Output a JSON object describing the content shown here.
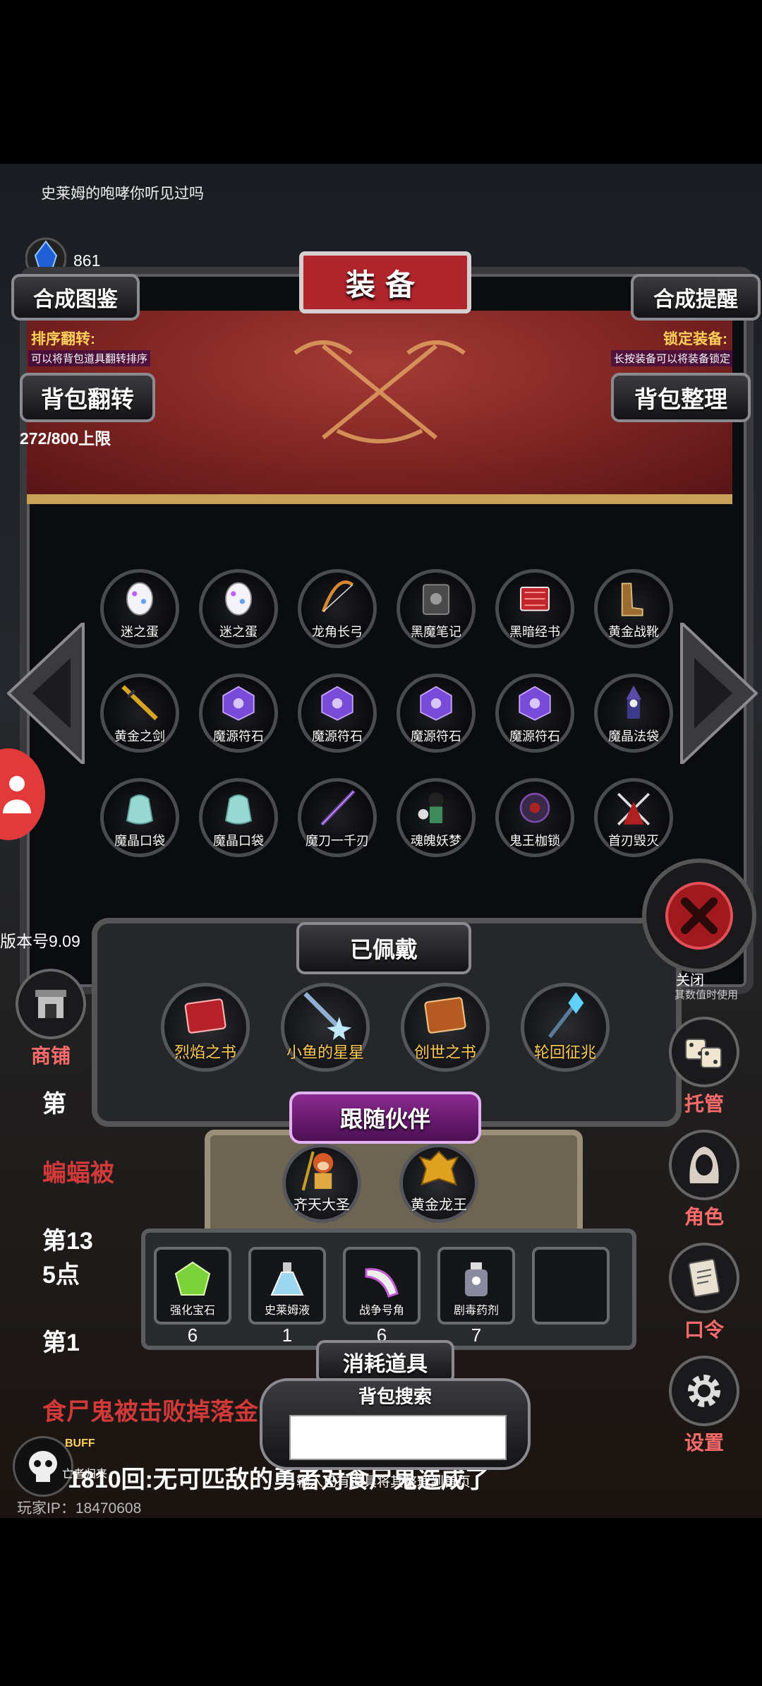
{
  "top_message": "史莱姆的咆哮你听见过吗",
  "currency": {
    "icon": "blue-crystal-icon",
    "value": "861"
  },
  "header": {
    "title": "装备",
    "codex_button": "合成图鉴",
    "synthesis_hint_button": "合成提醒",
    "sort_flip_label": "排序翻转:",
    "sort_flip_desc": "可以将背包道具翻转排序",
    "lock_label": "锁定装备:",
    "lock_desc": "长按装备可以将装备锁定",
    "flip_button": "背包翻转",
    "arrange_button": "背包整理",
    "capacity": "272/800上限"
  },
  "inventory": [
    {
      "label": "迷之蛋",
      "icon": "mystery-egg-icon",
      "color": "#f2f2f8"
    },
    {
      "label": "迷之蛋",
      "icon": "mystery-egg-icon",
      "color": "#f2f2f8"
    },
    {
      "label": "龙角长弓",
      "icon": "longbow-icon",
      "color": "#d68a2e"
    },
    {
      "label": "黑魔笔记",
      "icon": "dark-notebook-icon",
      "color": "#4a4a4a"
    },
    {
      "label": "黑暗经书",
      "icon": "red-scripture-icon",
      "color": "#c0262b"
    },
    {
      "label": "黄金战靴",
      "icon": "golden-boots-icon",
      "color": "#9c6b32"
    },
    {
      "label": "黄金之剑",
      "icon": "golden-sword-icon",
      "color": "#d8a520"
    },
    {
      "label": "魔源符石",
      "icon": "purple-rune-stone-icon",
      "color": "#7a4ad8"
    },
    {
      "label": "魔源符石",
      "icon": "purple-rune-stone-icon",
      "color": "#7a4ad8"
    },
    {
      "label": "魔源符石",
      "icon": "purple-rune-stone-icon",
      "color": "#7a4ad8"
    },
    {
      "label": "魔源符石",
      "icon": "purple-rune-stone-icon",
      "color": "#7a4ad8"
    },
    {
      "label": "魔晶法袋",
      "icon": "wizard-icon",
      "color": "#5b4aa8"
    },
    {
      "label": "魔晶口袋",
      "icon": "crystal-pouch-icon",
      "color": "#9ad8d4"
    },
    {
      "label": "魔晶口袋",
      "icon": "crystal-pouch-icon",
      "color": "#9ad8d4"
    },
    {
      "label": "魔刀一千刃",
      "icon": "dark-blade-icon",
      "color": "#6a3fa0"
    },
    {
      "label": "魂魄妖梦",
      "icon": "ghost-girl-icon",
      "color": "#3f8a5a"
    },
    {
      "label": "鬼王枷锁",
      "icon": "ghost-king-chain-icon",
      "color": "#3a2a4a"
    },
    {
      "label": "首刃毁灭",
      "icon": "crimson-reaper-icon",
      "color": "#b02020"
    }
  ],
  "version": "版本号9.09",
  "equipped": {
    "title": "已佩戴",
    "items": [
      {
        "label": "烈焰之书",
        "icon": "red-book-icon",
        "color": "#b8212a"
      },
      {
        "label": "小鱼的星星",
        "icon": "star-sword-icon",
        "color": "#bfe8ff"
      },
      {
        "label": "创世之书",
        "icon": "genesis-book-icon",
        "color": "#b55a22"
      },
      {
        "label": "轮回征兆",
        "icon": "ice-staff-icon",
        "color": "#5fd0ff"
      }
    ]
  },
  "partners": {
    "title": "跟随伙伴",
    "items": [
      {
        "label": "齐天大圣",
        "icon": "monkey-king-icon",
        "color": "#d55a28"
      },
      {
        "label": "黄金龙王",
        "icon": "golden-dragon-icon",
        "color": "#e0a020"
      }
    ]
  },
  "consumables": {
    "title": "消耗道具",
    "items": [
      {
        "label": "强化宝石",
        "count": "6",
        "icon": "green-gem-icon",
        "color": "#7bd23a"
      },
      {
        "label": "史莱姆液",
        "count": "1",
        "icon": "potion-flask-icon",
        "color": "#9cd6f0"
      },
      {
        "label": "战争号角",
        "count": "6",
        "icon": "war-horn-icon",
        "color": "#c35ad6"
      },
      {
        "label": "剧毒药剂",
        "count": "7",
        "icon": "poison-bottle-icon",
        "color": "#8a8aa0"
      },
      {
        "label": "",
        "count": "",
        "icon": "empty-slot-icon",
        "color": "#555"
      }
    ]
  },
  "search": {
    "title": "背包搜索",
    "placeholder": "",
    "hint": "输入已有道具将其整理到首页"
  },
  "close": {
    "label": "关闭",
    "sublabel": "其数值时使用"
  },
  "side_menu": [
    {
      "label": "商铺",
      "icon": "shop-icon"
    },
    {
      "label": "托管",
      "icon": "dice-icon"
    },
    {
      "label": "角色",
      "icon": "hooded-character-icon"
    },
    {
      "label": "口令",
      "icon": "scroll-icon"
    },
    {
      "label": "设置",
      "icon": "gear-icon"
    }
  ],
  "background_log": [
    "第",
    "蝙蝠被",
    "第13",
    "5点",
    "第1",
    "食尸鬼被击败掉落金币",
    "1810回:无可匹敌的勇者对食尸鬼造成了"
  ],
  "buff": {
    "label": "BUFF",
    "sublabel": "亡者归来"
  },
  "player_ip": "玩家IP：18470608"
}
